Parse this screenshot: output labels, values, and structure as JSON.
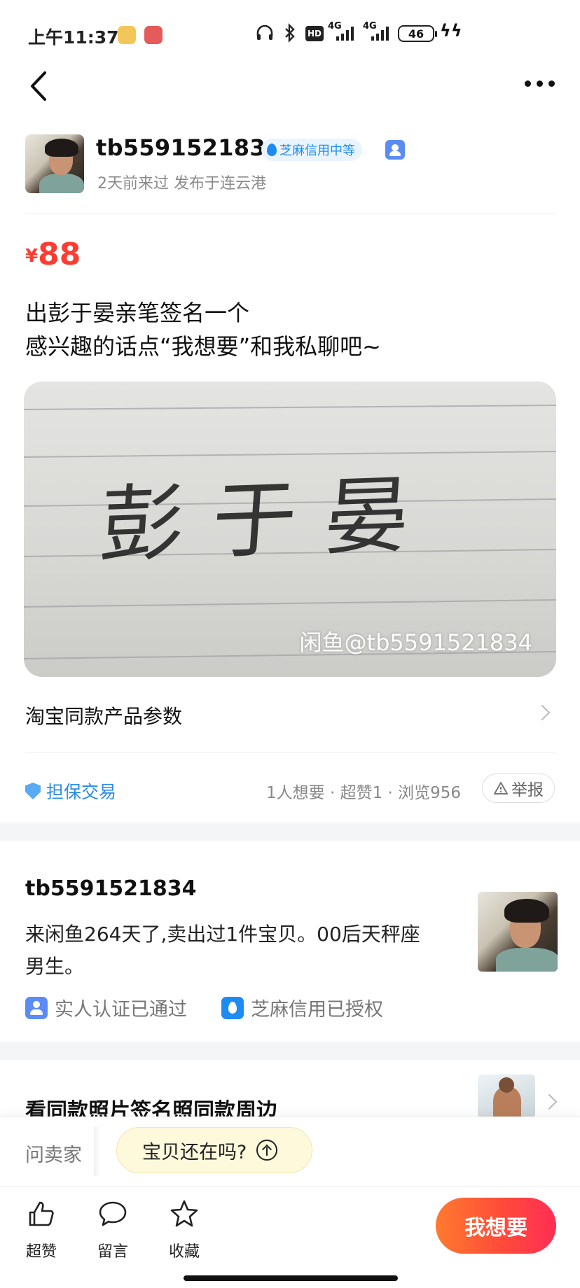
{
  "status_bar": {
    "time": "上午11:37",
    "net1": "4G",
    "net2": "4G",
    "hd": "HD",
    "battery": "46"
  },
  "seller": {
    "name": "tb5591521834",
    "credit_badge": "芝麻信用中等",
    "meta": "2天前来过 发布于连云港"
  },
  "item": {
    "currency": "¥",
    "price": "88",
    "desc_line1": "出彭于晏亲笔签名一个",
    "desc_line2": "感兴趣的话点“我想要”和我私聊吧~",
    "photo_watermark": "闲鱼@tb5591521834",
    "photo_handwriting": "彭于晏"
  },
  "params": {
    "label": "淘宝同款产品参数"
  },
  "trade": {
    "guarantee_label": "担保交易",
    "stats": "1人想要 · 超赞1 · 浏览956",
    "report_label": "举报"
  },
  "seller_card": {
    "name": "tb5591521834",
    "intro_line1": "来闲鱼264天了,卖出过1件宝贝。00后天秤座",
    "intro_line2": "男生。",
    "cert_real": "实人认证已通过",
    "cert_zhima": "芝麻信用已授权"
  },
  "related": {
    "title": "看同款照片签名照同款周边"
  },
  "ask": {
    "ask_seller": "问卖家",
    "quick_question": "宝贝还在吗?"
  },
  "bottom": {
    "like": "超赞",
    "comment": "留言",
    "favorite": "收藏",
    "want": "我想要"
  },
  "colors": {
    "price": "#ff3b30",
    "accent_blue": "#1d8cf0",
    "want_gradient_start": "#ff7a2e",
    "want_gradient_end": "#ff2d55"
  }
}
